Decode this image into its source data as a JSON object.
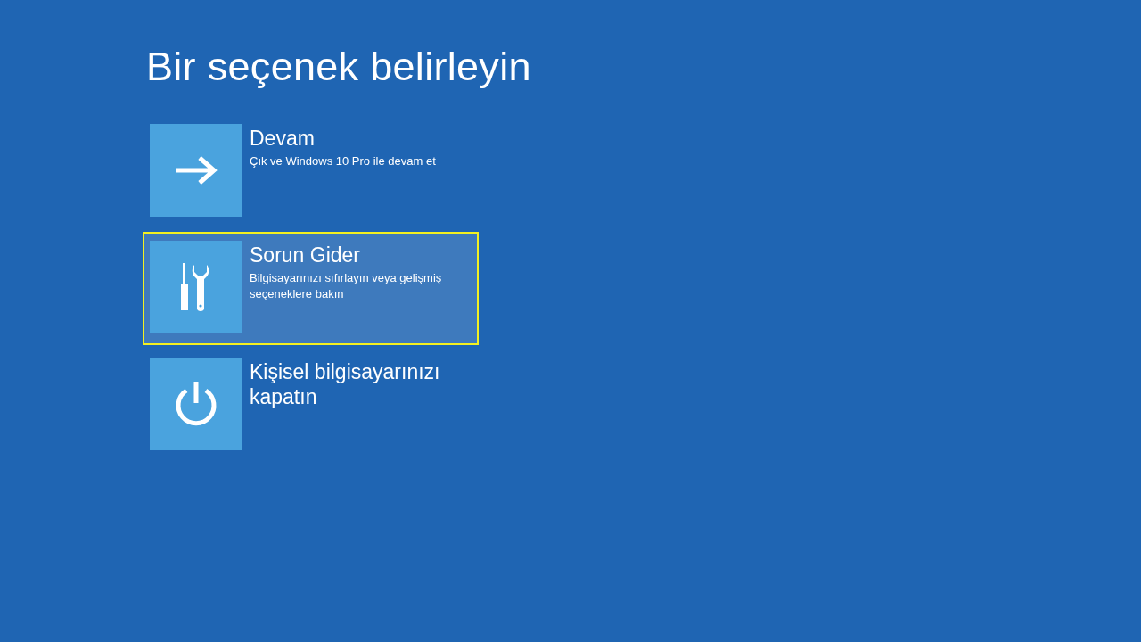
{
  "title": "Bir seçenek belirleyin",
  "options": [
    {
      "kind": "arrow",
      "label": "Devam",
      "description": "Çık ve Windows 10 Pro ile devam et",
      "selected": false
    },
    {
      "kind": "tools",
      "label": "Sorun Gider",
      "description": "Bilgisayarınızı sıfırlayın veya gelişmiş seçeneklere bakın",
      "selected": true
    },
    {
      "kind": "power",
      "label": "Kişisel bilgisayarınızı kapatın",
      "selected": false
    }
  ]
}
